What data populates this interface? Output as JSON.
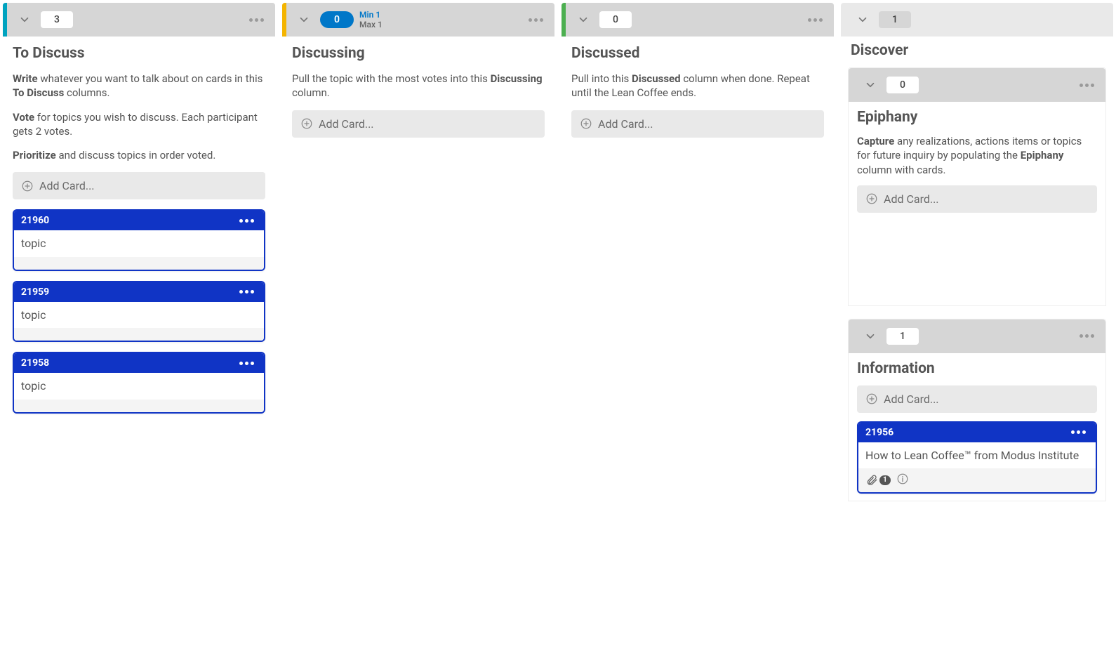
{
  "lanes": {
    "to_discuss": {
      "count": "3",
      "title": "To Discuss",
      "desc_write_lead": "Write",
      "desc_write_rest": " whatever you want to talk about on cards in this ",
      "desc_write_bold2": "To Discuss",
      "desc_write_rest2": " columns.",
      "desc_vote_lead": "Vote",
      "desc_vote_rest": " for topics you wish to discuss. Each participant gets 2 votes.",
      "desc_prio_lead": "Prioritize",
      "desc_prio_rest": " and discuss topics in order voted.",
      "add_card": "Add Card...",
      "cards": [
        {
          "id": "21960",
          "title": "topic"
        },
        {
          "id": "21959",
          "title": "topic"
        },
        {
          "id": "21958",
          "title": "topic"
        }
      ]
    },
    "discussing": {
      "count": "0",
      "min": "Min 1",
      "max": "Max 1",
      "title": "Discussing",
      "desc_a": "Pull the topic with the most votes into this ",
      "desc_bold": "Discussing",
      "desc_b": " column.",
      "add_card": "Add Card..."
    },
    "discussed": {
      "count": "0",
      "title": "Discussed",
      "desc_a": "Pull into this ",
      "desc_bold": "Discussed",
      "desc_b": " column when done. Repeat until the Lean Coffee ends.",
      "add_card": "Add Card..."
    },
    "discover": {
      "count": "1",
      "title": "Discover",
      "epiphany": {
        "count": "0",
        "title": "Epiphany",
        "desc_lead": "Capture",
        "desc_mid": " any realizations, actions items or topics for future inquiry by populating the ",
        "desc_bold2": "Epiphany",
        "desc_rest": " column with cards.",
        "add_card": "Add Card..."
      },
      "information": {
        "count": "1",
        "title": "Information",
        "add_card": "Add Card...",
        "card": {
          "id": "21956",
          "title": "How to Lean Coffee™ from Modus Institute",
          "attach_count": "1"
        }
      }
    }
  }
}
